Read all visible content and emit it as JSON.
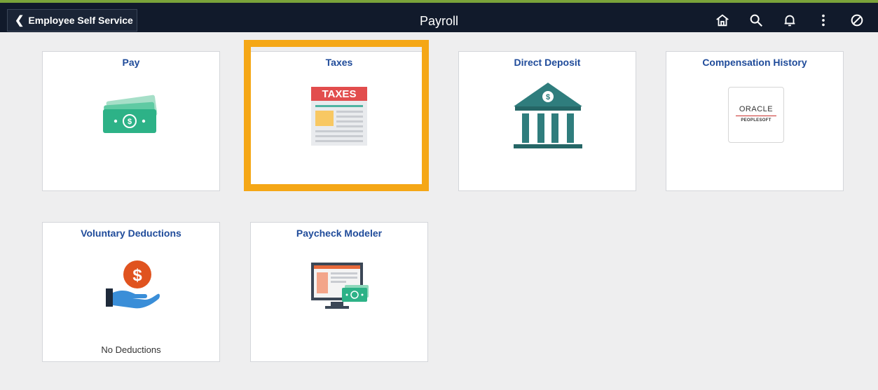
{
  "header": {
    "back_label": "Employee Self Service",
    "title": "Payroll",
    "icons": [
      "home-icon",
      "search-icon",
      "bell-icon",
      "more-icon",
      "navbar-icon"
    ]
  },
  "tiles": [
    {
      "title": "Pay",
      "icon": "money-icon"
    },
    {
      "title": "Taxes",
      "icon": "taxes-form-icon",
      "badge_text": "TAXES",
      "highlighted": true
    },
    {
      "title": "Direct Deposit",
      "icon": "bank-icon"
    },
    {
      "title": "Compensation History",
      "icon": "oracle-peoplesoft-logo",
      "logo_text": "ORACLE",
      "logo_subtext": "PEOPLESOFT"
    },
    {
      "title": "Voluntary Deductions",
      "icon": "hand-dollar-icon",
      "footer": "No Deductions"
    },
    {
      "title": "Paycheck Modeler",
      "icon": "monitor-money-icon"
    }
  ],
  "colors": {
    "header_bg": "#111a2b",
    "accent_top": "#7aa33a",
    "tile_title": "#1f4b9a",
    "highlight": "#f5a716",
    "bank_teal": "#2f7d7d",
    "money_green": "#2db287",
    "deduction_orange": "#e0531f"
  }
}
